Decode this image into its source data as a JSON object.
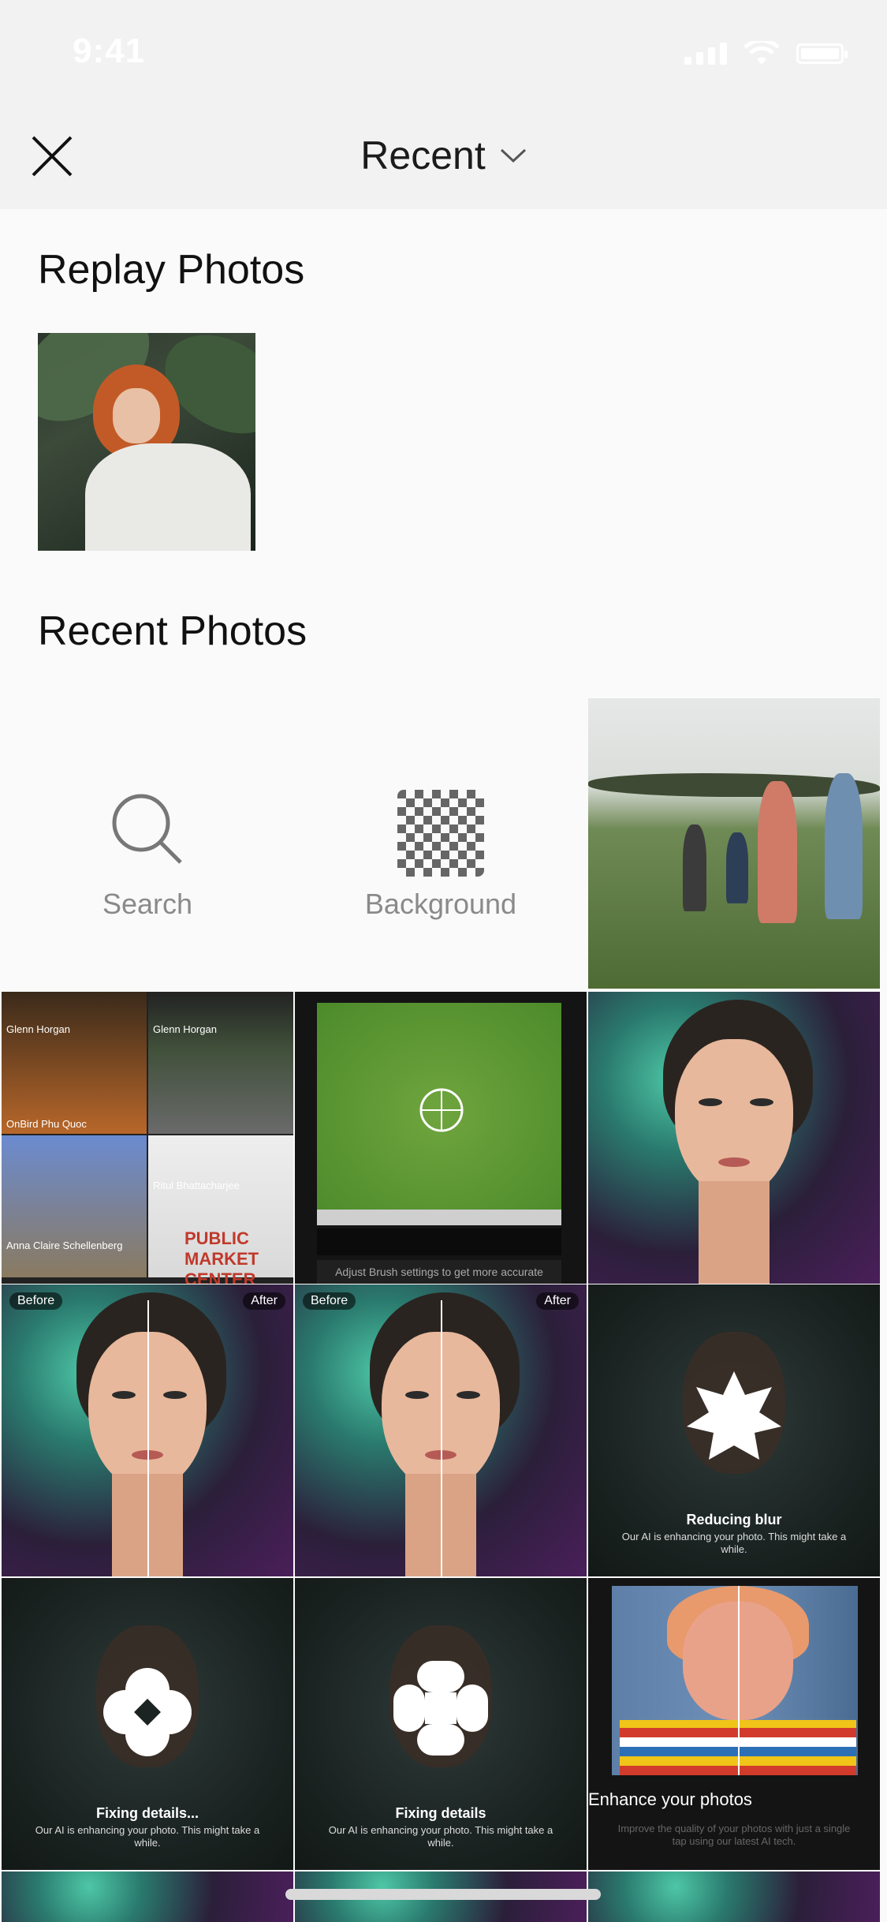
{
  "status_bar": {
    "time": "9:41"
  },
  "header": {
    "close_icon": "close-icon",
    "title": "Recent",
    "dropdown_icon": "chevron-down-icon"
  },
  "sections": {
    "replay_title": "Replay Photos",
    "recent_title": "Recent Photos"
  },
  "tools": [
    {
      "label": "Search",
      "icon": "search-icon"
    },
    {
      "label": "Background",
      "icon": "checkerboard-icon"
    }
  ],
  "collage_captions": [
    "Glenn Horgan",
    "Glenn Horgan",
    "OnBird Phu Quoc",
    "Ritul Bhattacharjee",
    "Anna Claire Schellenberg",
    "PUBLIC MARKET CENTER"
  ],
  "brush_hint": "Adjust Brush settings to get more accurate",
  "before_after": {
    "before": "Before",
    "after": "After"
  },
  "overlays": {
    "reducing_blur": "Reducing blur",
    "fixing_details_1": "Fixing details...",
    "fixing_details_2": "Fixing details",
    "ai_sub": "Our AI is enhancing your photo. This might take a while."
  },
  "enhance": {
    "title": "Enhance your photos",
    "sub": "Improve the quality of your photos with just a single tap using our latest AI tech."
  }
}
